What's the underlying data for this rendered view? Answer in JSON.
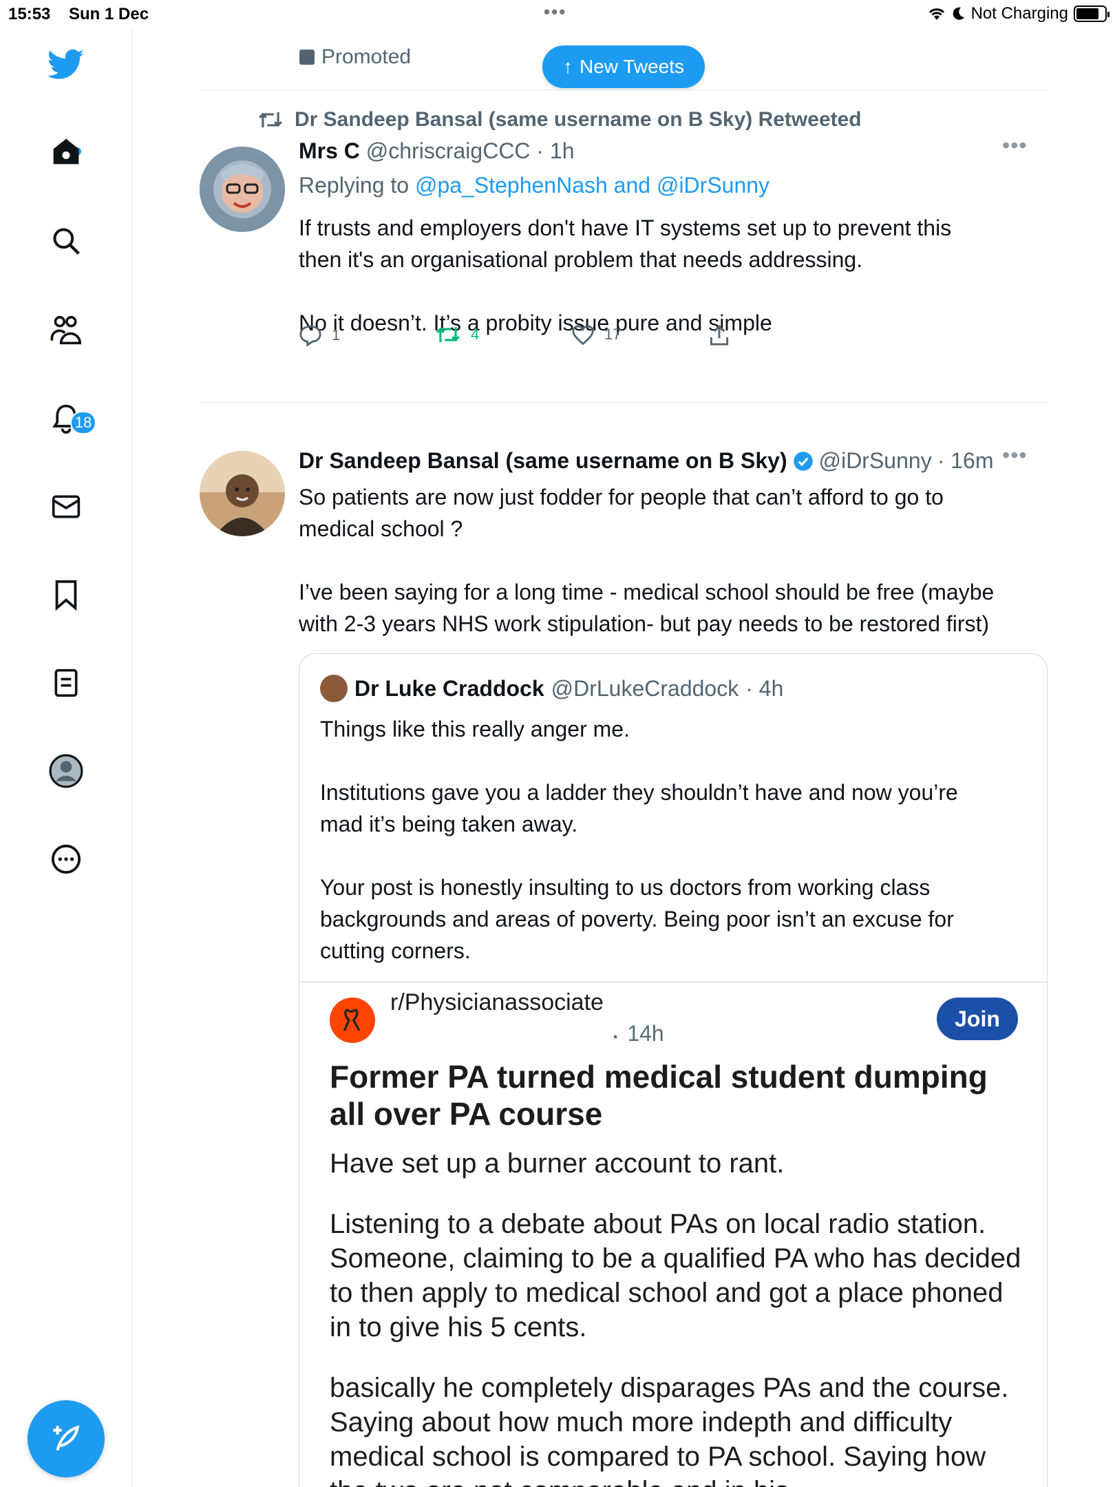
{
  "status_bar": {
    "time": "15:53",
    "date": "Sun 1 Dec",
    "battery": "Not Charging"
  },
  "sidebar": {
    "notifications_count": "18",
    "items": [
      "home-icon",
      "search-icon",
      "communities-icon",
      "notifications-icon",
      "messages-icon",
      "bookmarks-icon",
      "lists-icon",
      "profile-icon",
      "more-icon"
    ],
    "accent": "#1d9bf0"
  },
  "feed": {
    "promoted_label": "Promoted",
    "new_tweets_label": "New Tweets",
    "tweet1": {
      "retweet_context": "Dr Sandeep Bansal (same username on B Sky) Retweeted",
      "name": "Mrs C",
      "handle": "@chriscraigCCC",
      "time": "· 1h",
      "replying_prefix": "Replying to",
      "replying_to": "@pa_StephenNash and @iDrSunny",
      "line1": "If trusts and employers don't have IT systems set up to prevent this",
      "line2": "then it's an organisational problem that needs addressing.",
      "line3": "No it doesn’t. It’s a probity issue pure and simple",
      "replies": "1",
      "retweets": "4",
      "likes": "17"
    },
    "tweet2": {
      "name": "Dr Sandeep Bansal (same username on B Sky)",
      "handle": "@iDrSunny",
      "time": "· 16m",
      "line1": "So patients are now just fodder for people that can’t afford to go to",
      "line2": "medical school ?",
      "line3": "I’ve been saying for a long time - medical school should be free (maybe",
      "line4": "with 2-3 years NHS work stipulation- but pay needs to be restored first)"
    },
    "quote": {
      "name": "Dr Luke Craddock",
      "handle": "@DrLukeCraddock",
      "time": "· 4h",
      "line1": "Things like this really anger me.",
      "line2": "Institutions gave you a ladder they shouldn’t have and now you’re",
      "line3": "mad it’s being taken away.",
      "line4": "Your post is honestly insulting to us doctors from working class",
      "line5": "backgrounds and areas of poverty. Being poor isn’t an excuse for",
      "line6": "cutting corners."
    },
    "reddit": {
      "subreddit": "r/Physicianassociate",
      "age": "14h",
      "join_label": "Join",
      "title": "Former PA turned medical student dumping all over PA course",
      "p1": "Have set up a burner account to rant.",
      "p2": "Listening to a debate about PAs on local radio station. Someone, claiming to be a qualified PA who has decided to then apply to medical school and got a place phoned in to give his 5 cents.",
      "p3": "basically he completely disparages PAs and the course. Saying about how much more indepth and difficulty medical school is compared to PA school. Saying how the two are not comparable and in his"
    }
  }
}
